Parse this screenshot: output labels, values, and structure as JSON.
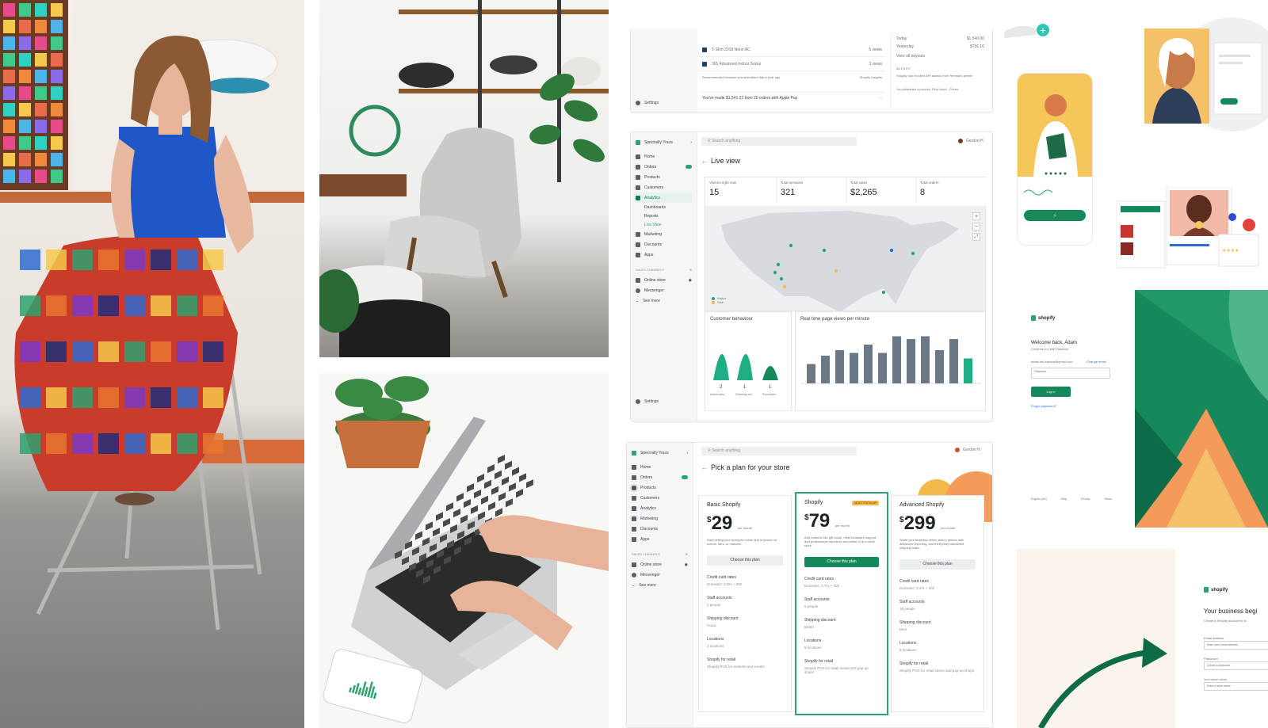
{
  "live_view_card": {
    "store_name": "Spectrally Yours",
    "search_placeholder": "Search anything",
    "user_name": "Gordon H.",
    "nav": [
      "Home",
      "Orders",
      "Products",
      "Customers",
      "Analytics",
      "Dashboards",
      "Reports",
      "Live View",
      "Marketing",
      "Discounts",
      "Apps"
    ],
    "sales_channels_label": "SALES CHANNELS",
    "channels": [
      "Online store",
      "Messenger",
      "See more"
    ],
    "settings_label": "Settings",
    "title": "Live view",
    "stats": [
      {
        "label": "Visitors right now",
        "value": "15"
      },
      {
        "label": "Total sessions",
        "value": "321"
      },
      {
        "label": "Total sales",
        "value": "$2,265"
      },
      {
        "label": "Total orders",
        "value": "8"
      }
    ],
    "legend": [
      "Visitor",
      "Sale"
    ],
    "behaviour_title": "Customer behaviour",
    "behaviour_values": [
      "2",
      "1",
      "1"
    ],
    "behaviour_labels": [
      "Active carts",
      "Checking out",
      "Purchased"
    ],
    "pageviews_title": "Real time page views per minute"
  },
  "top_card": {
    "rows": [
      {
        "text": "T-Shirt 2018 Neon AC",
        "meta": "5 views"
      },
      {
        "text": "365 Advanced Indoor Socks",
        "meta": "3 views"
      }
    ],
    "note": "Recommended because you advertised that a year ago",
    "note_link": "Shopify Insights",
    "summary": "You've made $1,541.22 from 20 orders with Apple Pay",
    "side_rows": [
      {
        "label": "Today",
        "value": "$1,540.00"
      },
      {
        "label": "Yesterday",
        "value": "$756.10"
      }
    ],
    "side_link": "View all payouts",
    "side_activity": "ACTIVITY",
    "side_activity_text": "Shopify has revoked API access from Remnant printer",
    "side_activity_text2": "You published a product, Plus Hood - Green",
    "settings_label": "Settings"
  },
  "plan_card": {
    "store_name": "Spectrally Yours",
    "search_placeholder": "Search anything",
    "user_name": "Gordon H.",
    "nav": [
      "Home",
      "Orders",
      "Products",
      "Customers",
      "Analytics",
      "Marketing",
      "Discounts",
      "Apps"
    ],
    "sales_channels_label": "SALES CHANNELS",
    "channels": [
      "Online store",
      "Messenger",
      "See more"
    ],
    "title": "Pick a plan for your store",
    "plans": [
      {
        "name": "Basic Shopify",
        "currency": "$",
        "price": "29",
        "period": "per month",
        "badge": "",
        "button": "Choose this plan",
        "desc": "Start selling your products online and in person at events, fairs, or markets."
      },
      {
        "name": "Shopify",
        "currency": "$",
        "price": "79",
        "period": "per month",
        "badge": "MOST POPULAR",
        "button": "Choose this plan",
        "desc": "Add features like gift cards, retail hardware support, and professional reports to sell online or at a retail store."
      },
      {
        "name": "Advanced Shopify",
        "currency": "$",
        "price": "299",
        "period": "per month",
        "badge": "",
        "button": "Choose this plan",
        "desc": "Scale your business online and in person with advanced reporting, and third party calculated shipping rates."
      }
    ],
    "features": [
      "Credit card rates",
      "Staff accounts",
      "Shipping discount",
      "Locations",
      "Shopify for retail"
    ],
    "feature_values": [
      [
        "Domestic: 2.9% + 30¢",
        "2 people",
        "Good",
        "4 locations",
        "Shopify POS for markets and events"
      ],
      [
        "Domestic: 2.7% + 30¢",
        "5 people",
        "Better",
        "5 locations",
        "Shopify POS for retail stores and pop-up shops"
      ],
      [
        "Domestic: 2.4% + 30¢",
        "15 people",
        "Best",
        "8 locations",
        "Shopify POS for retail stores and pop-up shops"
      ]
    ]
  },
  "login_card": {
    "logo": "shopify",
    "heading": "Welcome back, Adam",
    "subheading": "Continue to Little Histories",
    "email": "adam.stn.kasova@gmail.com",
    "change_link": "Change email",
    "password_label": "Password",
    "button": "Log in",
    "forgot_link": "Forgot password?",
    "footer": [
      "English (US)",
      "Help",
      "Privacy",
      "Terms"
    ]
  },
  "signup_card": {
    "logo": "shopify",
    "heading": "Your business begi",
    "subheading": "Create a Shopify account to st",
    "fields": [
      {
        "label": "Email address",
        "placeholder": "Enter your email address"
      },
      {
        "label": "Password",
        "placeholder": "Create a password"
      },
      {
        "label": "Your store name",
        "placeholder": "Enter a store name"
      }
    ]
  },
  "colors": {
    "brand_green": "#16885b",
    "accent_green": "#2ea36f",
    "chart_gray": "#5c6b78",
    "accent_orange": "#f49a5b",
    "accent_yellow": "#f5b84b"
  }
}
